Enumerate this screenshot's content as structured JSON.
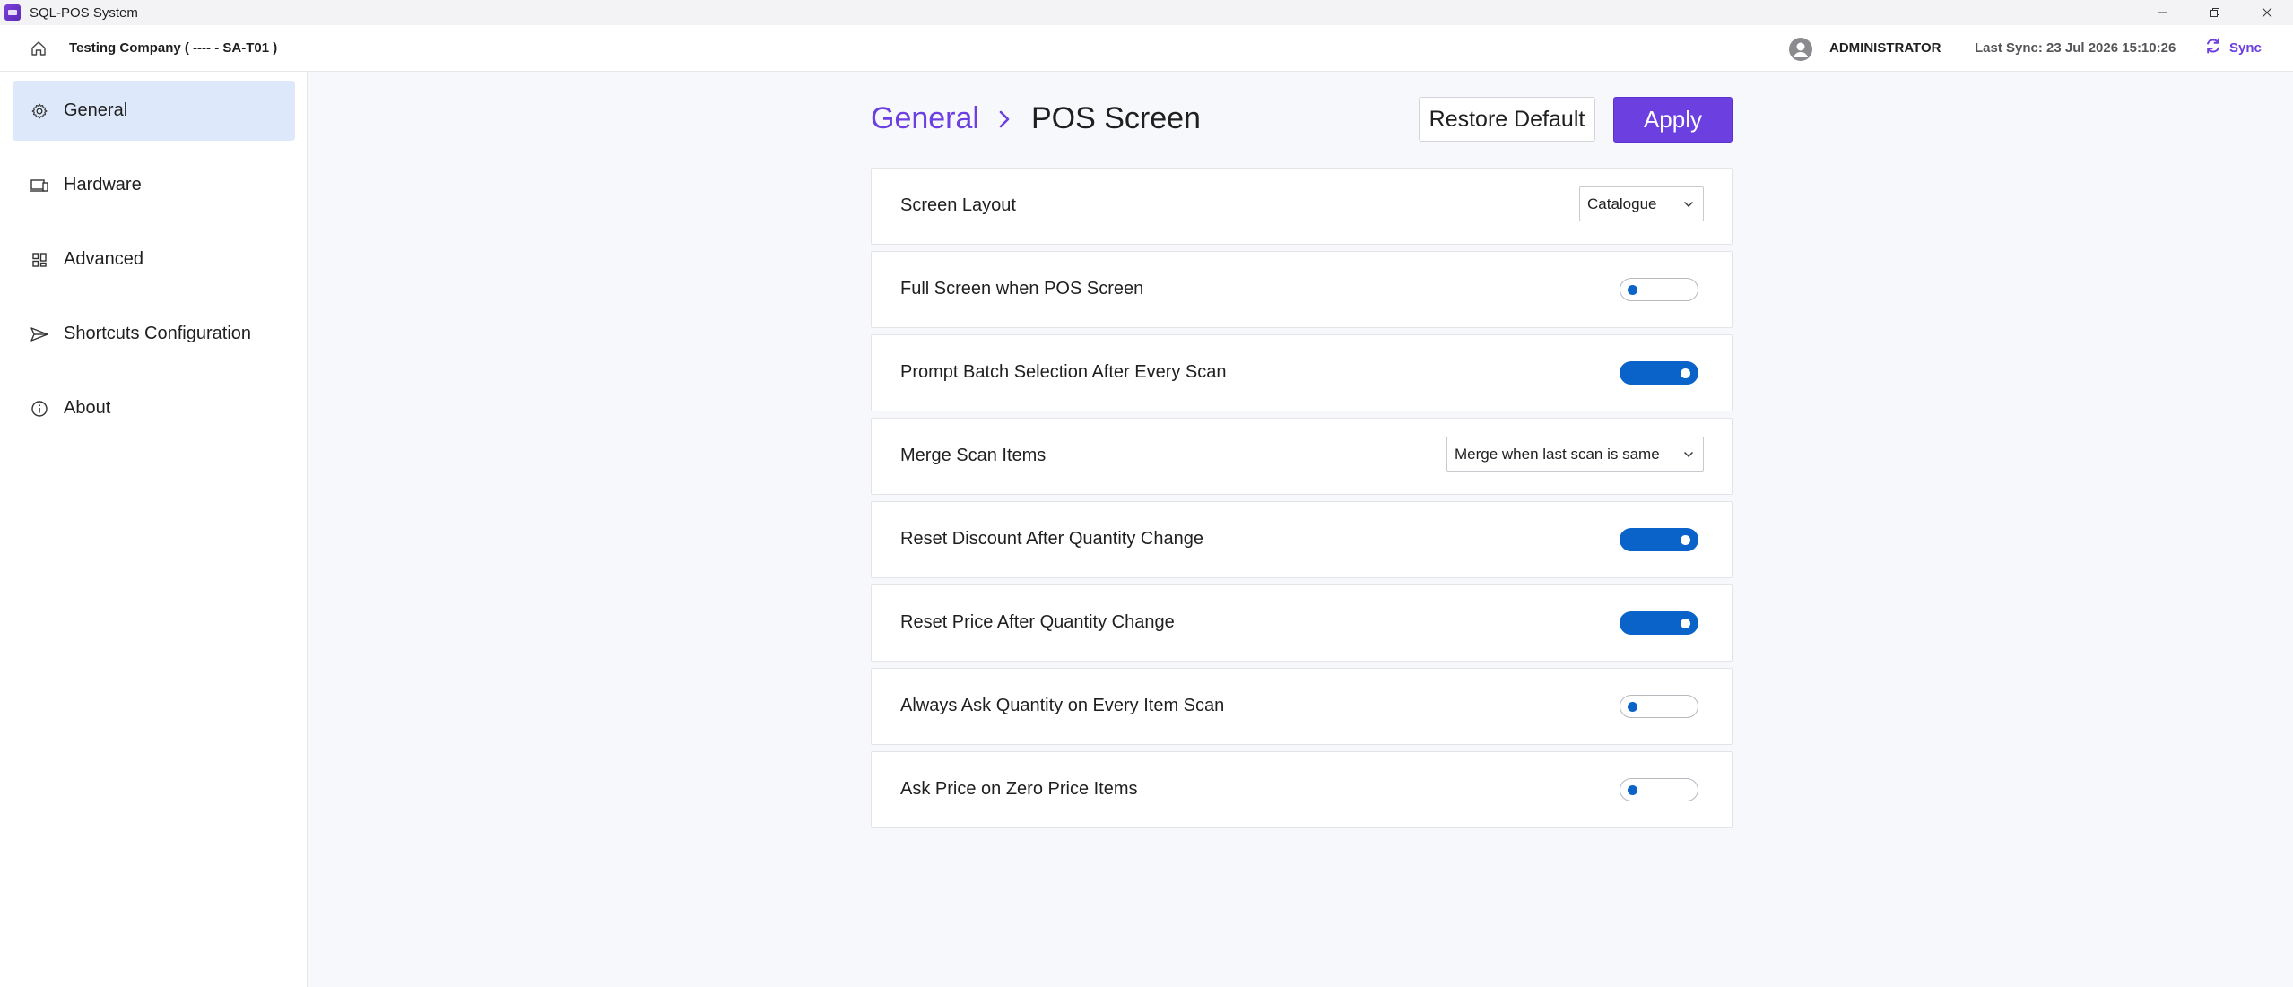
{
  "window": {
    "title": "SQL-POS System",
    "controls": [
      "minimize-icon",
      "restore-icon",
      "close-icon"
    ]
  },
  "header": {
    "company": "Testing Company ( ---- - SA-T01 )",
    "user": "ADMINISTRATOR",
    "last_sync": "Last Sync: 23 Jul 2026 15:10:26",
    "sync_label": "Sync"
  },
  "sidebar": {
    "items": [
      {
        "label": "General",
        "icon": "gear-icon",
        "active": true
      },
      {
        "label": "Hardware",
        "icon": "devices-icon",
        "active": false
      },
      {
        "label": "Advanced",
        "icon": "grid-icon",
        "active": false
      },
      {
        "label": "Shortcuts Configuration",
        "icon": "send-icon",
        "active": false
      },
      {
        "label": "About",
        "icon": "info-icon",
        "active": false
      }
    ]
  },
  "main": {
    "breadcrumb": {
      "parent": "General",
      "current": "POS Screen"
    },
    "restore_label": "Restore Default",
    "apply_label": "Apply",
    "settings": [
      {
        "label": "Screen Layout",
        "type": "select",
        "value": "Catalogue"
      },
      {
        "label": "Full Screen when POS Screen",
        "type": "toggle",
        "on": false
      },
      {
        "label": "Prompt Batch Selection After Every Scan",
        "type": "toggle",
        "on": true
      },
      {
        "label": "Merge Scan Items",
        "type": "select",
        "value": "Merge when last scan is same"
      },
      {
        "label": "Reset Discount After Quantity Change",
        "type": "toggle",
        "on": true
      },
      {
        "label": "Reset Price After Quantity Change",
        "type": "toggle",
        "on": true
      },
      {
        "label": "Always Ask Quantity on Every Item Scan",
        "type": "toggle",
        "on": false
      },
      {
        "label": "Ask Price on Zero Price Items",
        "type": "toggle",
        "on": false
      }
    ]
  },
  "colors": {
    "accent": "#6b3fe0",
    "toggle_on": "#0a63c9",
    "active_nav": "#dde9fb"
  }
}
